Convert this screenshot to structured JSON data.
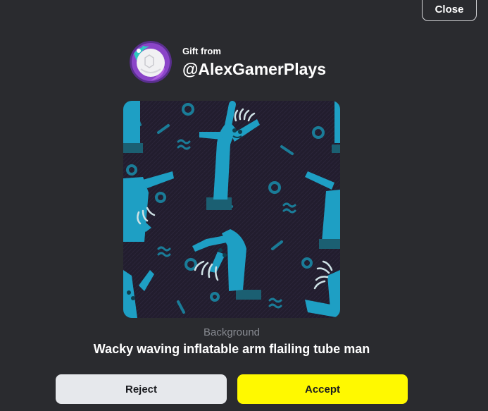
{
  "dialog": {
    "close_label": "Close"
  },
  "sender": {
    "caption": "Gift from",
    "username": "@AlexGamerPlays",
    "avatar_icon": "user-avatar"
  },
  "item": {
    "type_label": "Background",
    "name": "Wacky waving inflatable arm flailing tube man",
    "image_icon": "tube-man-pattern",
    "colors": {
      "background": "#221d2e",
      "figure": "#1e9fc4",
      "base": "#1b5f72"
    }
  },
  "actions": {
    "reject_label": "Reject",
    "accept_label": "Accept"
  },
  "colors": {
    "page_background": "#2a2b2f",
    "accept_button": "#fff900",
    "reject_button": "#e6e8ec"
  }
}
